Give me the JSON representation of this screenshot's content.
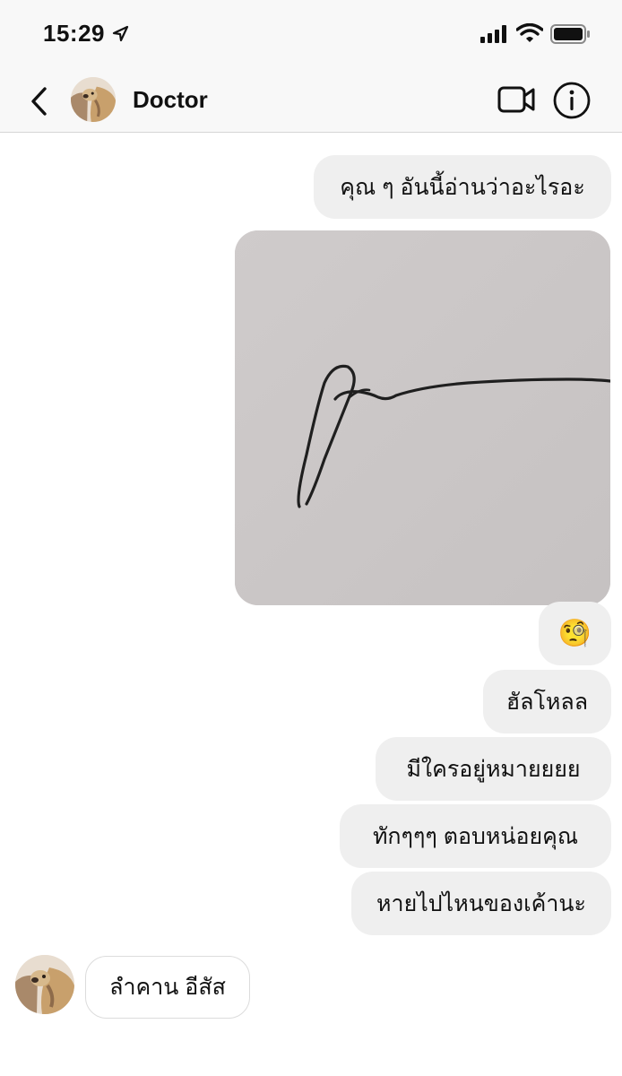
{
  "status": {
    "time": "15:29"
  },
  "header": {
    "contact_name": "Doctor"
  },
  "messages": {
    "m1": "คุณ ๆ อันนี้อ่านว่าอะไรอะ",
    "m2": "🧐",
    "m3": "ฮัลโหลล",
    "m4": "มีใครอยู่หมายยยย",
    "m5": "ทักๆๆๆ ตอบหน่อยคุณ",
    "m6": "หายไปไหนของเค้านะ",
    "reply": "ลำคาน อีสัส"
  },
  "icons": [
    "location-arrow-icon",
    "signal-icon",
    "wifi-icon",
    "battery-icon",
    "back-chevron-icon",
    "video-call-icon",
    "info-icon"
  ],
  "colors": {
    "outgoing_bubble": "#efefef",
    "header_bg": "#f8f8f8",
    "photo_paper": "#cbc7c7"
  }
}
